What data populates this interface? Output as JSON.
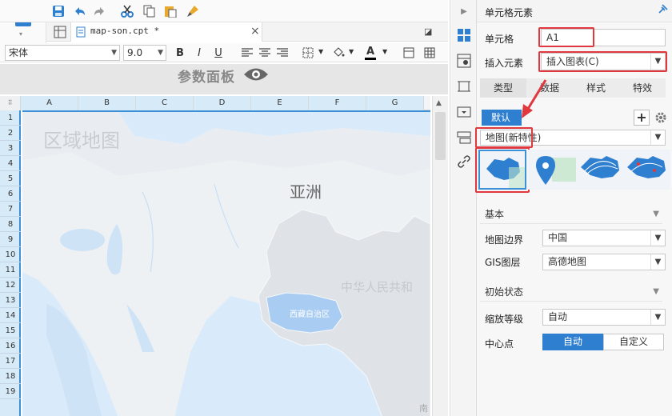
{
  "toolbar": {
    "icons": [
      "save-icon",
      "undo-icon",
      "redo-icon",
      "cut-icon",
      "copy-icon",
      "paste-icon",
      "format-painter-icon"
    ]
  },
  "tab": {
    "name": "map-son.cpt *",
    "close": "×"
  },
  "format": {
    "font": "宋体",
    "size": "9.0",
    "bold": "B",
    "italic": "I",
    "underline": "U",
    "textcolor": "A"
  },
  "param": {
    "title": "参数面板"
  },
  "grid": {
    "columns": [
      "A",
      "B",
      "C",
      "D",
      "E",
      "F",
      "G"
    ],
    "rows": [
      "1",
      "2",
      "3",
      "4",
      "5",
      "6",
      "7",
      "8",
      "9",
      "10",
      "11",
      "12",
      "13",
      "14",
      "15",
      "16",
      "17",
      "18",
      "19"
    ]
  },
  "map": {
    "title": "区域地图",
    "continent": "亚洲",
    "country": "中华人民共和",
    "region": "西藏自治区",
    "corner": "南"
  },
  "panel": {
    "header": "单元格元素",
    "cell_label": "单元格",
    "cell_value": "A1",
    "insert_label": "插入元素",
    "insert_value": "插入图表(C)",
    "tabs": [
      "类型",
      "数据",
      "样式",
      "特效"
    ],
    "default_tag": "默认",
    "map_type": "地图(新特性)",
    "basic": "基本",
    "border_label": "地图边界",
    "border_value": "中国",
    "gis_label": "GIS图层",
    "gis_value": "高德地图",
    "initial": "初始状态",
    "zoom_label": "缩放等级",
    "zoom_value": "自动",
    "center_label": "中心点",
    "center_auto": "自动",
    "center_custom": "自定义"
  },
  "colors": {
    "accent": "#3d8fd6",
    "highlight": "#e0383e",
    "map_sea": "#d9ebfa",
    "map_land": "#eef1f4",
    "china": "#dfe2e6",
    "tibet": "#a9cdf2"
  }
}
